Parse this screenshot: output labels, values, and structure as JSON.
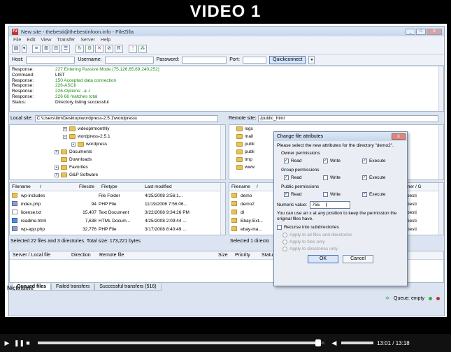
{
  "video": {
    "title": "VIDEO 1",
    "time_current": "13:01",
    "time_total": "13:18",
    "time_sep": " / ",
    "progress_fraction": 0.978
  },
  "window": {
    "title": "New site - thebesti@thebestinfoon.info - FileZilla",
    "logo": "Fz",
    "min": "_",
    "max": "□",
    "close": "X"
  },
  "menu": [
    "File",
    "Edit",
    "View",
    "Transfer",
    "Server",
    "Help"
  ],
  "toolbar_icons": [
    "site-manager-icon",
    "dropdown-icon",
    "toggle-log-icon",
    "toggle-local-tree-icon",
    "toggle-remote-tree-icon",
    "toggle-queue-icon",
    "refresh-icon",
    "process-queue-icon",
    "cancel-icon",
    "disconnect-icon",
    "reconnect-icon",
    "filter-icon",
    "compare-icon"
  ],
  "quickconnect": {
    "host_label": "Host:",
    "username_label": "Username:",
    "password_label": "Password:",
    "port_label": "Port:",
    "button": "Quickconnect",
    "dropdown": "▼"
  },
  "log": [
    {
      "tag": "Response:",
      "msg": "227 Entering Passive Mode (75,126,65,69,240,252)",
      "green": true
    },
    {
      "tag": "Command:",
      "msg": "LIST",
      "green": false
    },
    {
      "tag": "Response:",
      "msg": "150 Accepted data connection",
      "green": true
    },
    {
      "tag": "Response:",
      "msg": "226-ASCII",
      "green": true
    },
    {
      "tag": "Response:",
      "msg": "226-Options: -a -l",
      "green": true
    },
    {
      "tag": "Response:",
      "msg": "226 66 matches total",
      "green": true
    },
    {
      "tag": "Status:",
      "msg": "Directory listing successful",
      "green": false
    }
  ],
  "local": {
    "label": "Local site:",
    "path": "C:\\Users\\tim\\Desktop\\wordpress-2.5.1\\wordpress\\",
    "tree": [
      {
        "name": "videoplrmonthly",
        "level": 2,
        "box": "+"
      },
      {
        "name": "wordpress-2.5.1",
        "level": 2,
        "box": "-"
      },
      {
        "name": "wordpress",
        "level": 3,
        "box": "+"
      },
      {
        "name": "Documents",
        "level": 1,
        "box": "+"
      },
      {
        "name": "Downloads",
        "level": 1,
        "box": ""
      },
      {
        "name": "Favorites",
        "level": 1,
        "box": "+"
      },
      {
        "name": "G&P Software",
        "level": 1,
        "box": "+"
      }
    ],
    "columns": [
      "Filename",
      "/",
      "Filesize",
      "Filetype",
      "Last modified"
    ],
    "files": [
      {
        "name": "wp-includes",
        "size": "",
        "type": "File Folder",
        "modified": "4/25/2008 3:56:1...",
        "icon": "folder"
      },
      {
        "name": "index.php",
        "size": "94",
        "type": "PHP File",
        "modified": "11/19/2006 7:56:06...",
        "icon": "php"
      },
      {
        "name": "license.txt",
        "size": "15,407",
        "type": "Text Document",
        "modified": "3/22/2008 9:34:26 PM",
        "icon": "txt"
      },
      {
        "name": "readme.html",
        "size": "7,638",
        "type": "HTML Docum...",
        "modified": "4/25/2008 2:09:44 ...",
        "icon": "html"
      },
      {
        "name": "wp-app.php",
        "size": "32,776",
        "type": "PHP File",
        "modified": "3/17/2008 8:40:49 ...",
        "icon": "php"
      }
    ],
    "status": "Selected 22 files and 3 directories. Total size: 173,221 bytes"
  },
  "remote": {
    "label": "Remote site:",
    "path": "/public_html",
    "tree": [
      "logs",
      "mail",
      "publi",
      "publi",
      "tmp",
      "www"
    ],
    "columns": [
      "Filename",
      "/",
      "ns",
      "Owner / G"
    ],
    "files": [
      {
        "name": "demo",
        "owner": "thebesti"
      },
      {
        "name": "demo2",
        "owner": "thebesti"
      },
      {
        "name": "dl",
        "owner": "thebesti"
      },
      {
        "name": "Ebay-Ext...",
        "owner": "thebesti"
      },
      {
        "name": "ebay-ma...",
        "owner": "thebesti"
      }
    ],
    "status": "Selected 1 directo"
  },
  "queue": {
    "columns": [
      "Server / Local file",
      "Direction",
      "Remote file",
      "Size",
      "Priority",
      "Statu"
    ]
  },
  "queue_tabs": [
    "Queued files",
    "Failed transfers",
    "Successful transfers (516)"
  ],
  "bottom": {
    "queue_status": "Queue: empty"
  },
  "dialog": {
    "title": "Change file attributes",
    "close": "X",
    "intro": "Please select the new attributes for the directory \"demo2\".",
    "groups": [
      {
        "label": "Owner permissions",
        "read": true,
        "write": true,
        "execute": true
      },
      {
        "label": "Group permissions",
        "read": true,
        "write": false,
        "execute": true
      },
      {
        "label": "Public permissions",
        "read": true,
        "write": false,
        "execute": true
      }
    ],
    "read_label": "Read",
    "write_label": "Write",
    "execute_label": "Execute",
    "numeric_label": "Numeric value:",
    "numeric_value": "755",
    "note": "You can use an x at any position to keep the permission the original files have.",
    "recurse_label": "Recurse into subdirectories",
    "radios": [
      "Apply to all files and directories",
      "Apply to files only",
      "Apply to directories only"
    ],
    "ok": "OK",
    "cancel": "Cancel"
  },
  "nickname": "Nickname"
}
